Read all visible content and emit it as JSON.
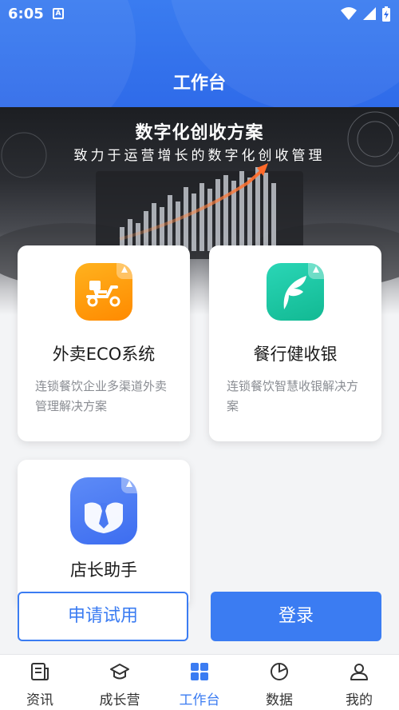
{
  "status_bar": {
    "time": "6:05",
    "notification_icon": "A"
  },
  "header": {
    "title": "工作台"
  },
  "banner": {
    "title": "数字化创收方案",
    "subtitle": "致力于运营增长的数字化创收管理"
  },
  "cards": [
    {
      "title": "外卖ECO系统",
      "description": "连锁餐饮企业多渠道外卖管理解决方案",
      "icon": "scooter-icon",
      "color": "#ff9a00"
    },
    {
      "title": "餐行健收银",
      "description": "连锁餐饮智慧收银解决方案",
      "icon": "leaf-icon",
      "color": "#1cc7a4"
    },
    {
      "title": "店长助手",
      "description": "",
      "icon": "manager-tie-icon",
      "color": "#4a79f2"
    }
  ],
  "actions": {
    "trial": "申请试用",
    "login": "登录"
  },
  "bottom_nav": {
    "items": [
      {
        "label": "资讯",
        "icon": "news-icon"
      },
      {
        "label": "成长营",
        "icon": "graduation-cap-icon"
      },
      {
        "label": "工作台",
        "icon": "grid-icon",
        "active": true
      },
      {
        "label": "数据",
        "icon": "pie-chart-icon"
      },
      {
        "label": "我的",
        "icon": "profile-icon"
      }
    ]
  },
  "colors": {
    "primary": "#3b7cf2",
    "header": "#2f6be9"
  }
}
